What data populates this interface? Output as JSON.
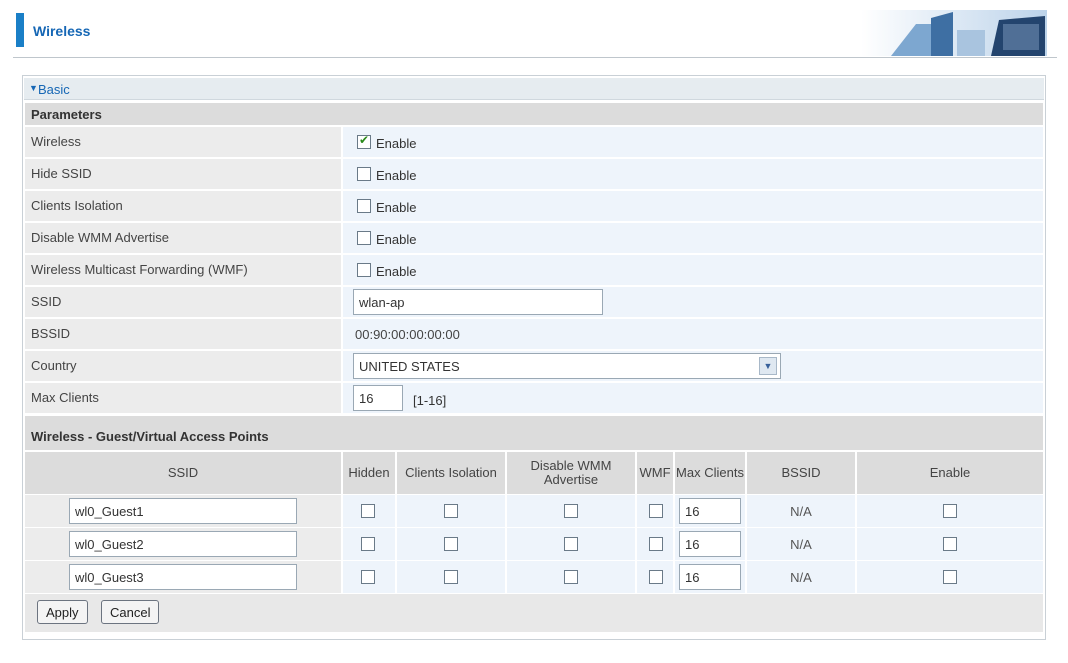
{
  "header": {
    "title": "Wireless"
  },
  "section": {
    "title": "Basic"
  },
  "parameters": {
    "heading": "Parameters",
    "wireless": {
      "label": "Wireless",
      "option": "Enable",
      "checked": true
    },
    "hide_ssid": {
      "label": "Hide SSID",
      "option": "Enable",
      "checked": false
    },
    "clients_isolation": {
      "label": "Clients Isolation",
      "option": "Enable",
      "checked": false
    },
    "disable_wmm": {
      "label": "Disable WMM Advertise",
      "option": "Enable",
      "checked": false
    },
    "wmf": {
      "label": "Wireless Multicast Forwarding (WMF)",
      "option": "Enable",
      "checked": false
    },
    "ssid": {
      "label": "SSID",
      "value": "wlan-ap"
    },
    "bssid": {
      "label": "BSSID",
      "value": "00:90:00:00:00:00"
    },
    "country": {
      "label": "Country",
      "value": "UNITED STATES"
    },
    "max_clients": {
      "label": "Max Clients",
      "value": "16",
      "range": "[1-16]"
    }
  },
  "guest": {
    "heading": "Wireless - Guest/Virtual Access Points",
    "columns": [
      "SSID",
      "Hidden",
      "Clients Isolation",
      "Disable WMM Advertise",
      "WMF",
      "Max Clients",
      "BSSID",
      "Enable"
    ],
    "rows": [
      {
        "ssid": "wl0_Guest1",
        "max_clients": "16",
        "bssid": "N/A"
      },
      {
        "ssid": "wl0_Guest2",
        "max_clients": "16",
        "bssid": "N/A"
      },
      {
        "ssid": "wl0_Guest3",
        "max_clients": "16",
        "bssid": "N/A"
      }
    ]
  },
  "buttons": {
    "apply": "Apply",
    "cancel": "Cancel"
  },
  "colors": {
    "accent": "#1667b5",
    "header_bar": "#1a7fc7"
  }
}
